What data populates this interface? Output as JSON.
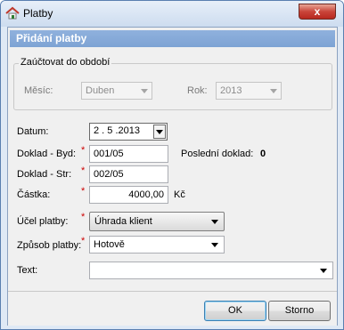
{
  "window": {
    "title": "Platby",
    "close_glyph": "x"
  },
  "header": {
    "title": "Přidání platby"
  },
  "period": {
    "legend": "Zaúčtovat do období",
    "month_label": "Měsíc:",
    "month_value": "Duben",
    "year_label": "Rok:",
    "year_value": "2013"
  },
  "form": {
    "date_label": "Datum:",
    "date_value": "2 . 5 .2013",
    "doc_byd_label": "Doklad - Byd:",
    "doc_byd_value": "001/05",
    "last_doc_label": "Poslední doklad:",
    "last_doc_value": "0",
    "doc_str_label": "Doklad - Str:",
    "doc_str_value": "002/05",
    "amount_label": "Částka:",
    "amount_value": "4000,00",
    "currency": "Kč",
    "purpose_label": "Účel platby:",
    "purpose_value": "Úhrada klient",
    "method_label": "Způsob platby:",
    "method_value": "Hotově",
    "text_label": "Text:",
    "text_value": "",
    "required_mark": "*"
  },
  "buttons": {
    "ok": "OK",
    "cancel": "Storno"
  }
}
